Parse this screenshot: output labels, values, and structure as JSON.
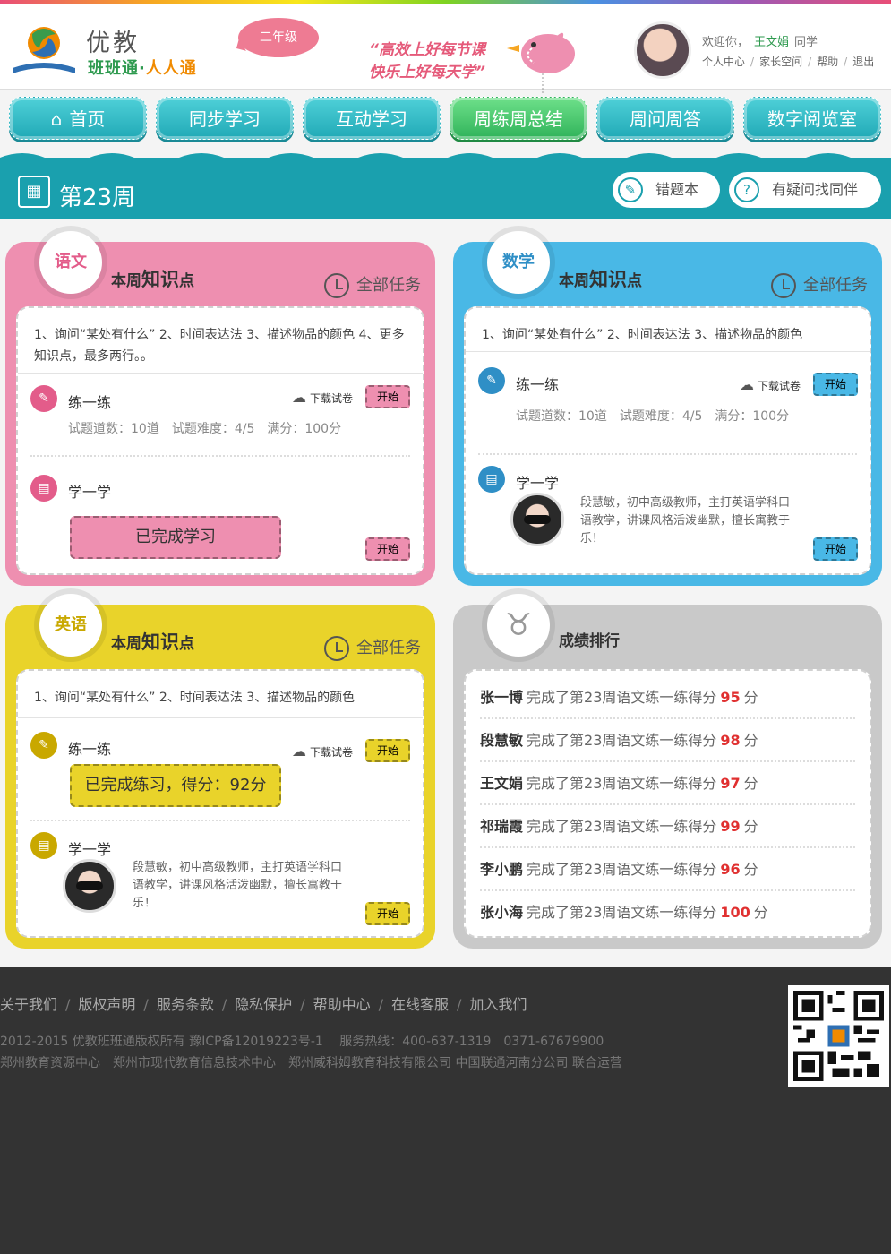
{
  "header": {
    "logo_line1": "优教",
    "logo_line2a": "班班通",
    "logo_sep": "·",
    "logo_line2b": "人人通",
    "grade": "二年级",
    "slogan_line1": "“高效上好每节课",
    "slogan_line2": "快乐上好每天学”",
    "welcome_prefix": "欢迎你，",
    "user_name": "王文娟",
    "welcome_suffix": "同学",
    "links": [
      "个人中心",
      "家长空间",
      "帮助",
      "退出"
    ],
    "link_sep": "/"
  },
  "nav": [
    {
      "label": "首页",
      "icon": "home-icon"
    },
    {
      "label": "同步学习"
    },
    {
      "label": "互动学习"
    },
    {
      "label": "周练周总结",
      "active": true
    },
    {
      "label": "周问周答"
    },
    {
      "label": "数字阅览室"
    }
  ],
  "week": {
    "title": "第23周",
    "btn_wrong": "错题本",
    "btn_ask": "有疑问找同伴"
  },
  "cards": {
    "chinese": {
      "subject": "语文",
      "title_prefix": "本周",
      "title_bold": "知识",
      "title_suffix": "点",
      "alltask": "全部任务",
      "knowledge": "1、询问“某处有什么” 2、时间表达法 3、描述物品的颜色 4、更多知识点，最多两行。。",
      "practice_label": "练一练",
      "download": "下载试卷",
      "start": "开始",
      "meta": "试题道数：10道　试题难度：4/5　满分：100分",
      "study_label": "学一学",
      "done_study": "已完成学习",
      "color": "#ee8fb0"
    },
    "math": {
      "subject": "数学",
      "title_prefix": "本周",
      "title_bold": "知识",
      "title_suffix": "点",
      "alltask": "全部任务",
      "knowledge": "1、询问“某处有什么” 2、时间表达法 3、描述物品的颜色",
      "practice_label": "练一练",
      "download": "下载试卷",
      "start": "开始",
      "meta": "试题道数：10道　试题难度：4/5　满分：100分",
      "study_label": "学一学",
      "teacher_desc": "段慧敏，初中高级教师，主打英语学科口语教学，讲课风格活泼幽默，擅长寓教于乐！",
      "color": "#49b8e6"
    },
    "english": {
      "subject": "英语",
      "title_prefix": "本周",
      "title_bold": "知识",
      "title_suffix": "点",
      "alltask": "全部任务",
      "knowledge": "1、询问“某处有什么” 2、时间表达法 3、描述物品的颜色",
      "practice_label": "练一练",
      "download": "下载试卷",
      "start": "开始",
      "done_practice": "已完成练习，得分：92分",
      "study_label": "学一学",
      "teacher_desc": "段慧敏，初中高级教师，主打英语学科口语教学，讲课风格活泼幽默，擅长寓教于乐！",
      "color": "#e9d32a"
    },
    "ranking": {
      "title": "成绩排行",
      "color": "#c9c9c9",
      "rows": [
        {
          "name": "张一博",
          "text": "完成了第23周语文练一练得分",
          "score": "95",
          "unit": "分"
        },
        {
          "name": "段慧敏",
          "text": "完成了第23周语文练一练得分",
          "score": "98",
          "unit": "分"
        },
        {
          "name": "王文娟",
          "text": "完成了第23周语文练一练得分",
          "score": "97",
          "unit": "分"
        },
        {
          "name": "祁瑞霞",
          "text": "完成了第23周语文练一练得分",
          "score": "99",
          "unit": "分"
        },
        {
          "name": "李小鹏",
          "text": "完成了第23周语文练一练得分",
          "score": "96",
          "unit": "分"
        },
        {
          "name": "张小海",
          "text": "完成了第23周语文练一练得分",
          "score": "100",
          "unit": "分"
        }
      ]
    }
  },
  "footer": {
    "links": [
      "关于我们",
      "版权声明",
      "服务条款",
      "隐私保护",
      "帮助中心",
      "在线客服",
      "加入我们"
    ],
    "sep": "/",
    "line1": "2012-2015 优教班班通版权所有  豫ICP备12019223号-1　 服务热线：400-637-1319　0371-67679900",
    "line2": "郑州教育资源中心　郑州市现代教育信息技术中心　郑州威科姆教育科技有限公司 中国联通河南分公司  联合运营"
  }
}
